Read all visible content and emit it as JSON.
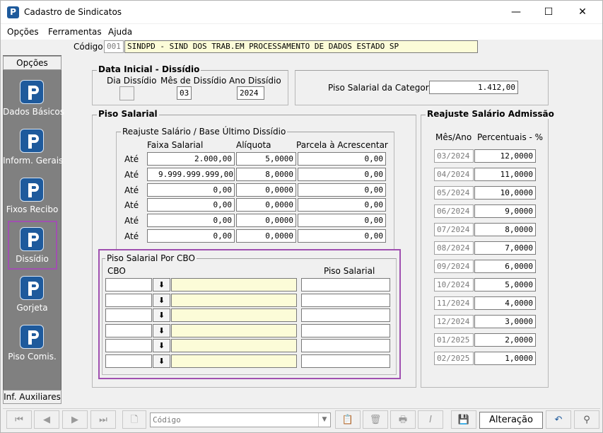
{
  "window": {
    "title": "Cadastro de Sindicatos",
    "minimize": "—",
    "maximize": "☐",
    "close": "✕"
  },
  "menu": [
    "Opções",
    "Ferramentas",
    "Ajuda"
  ],
  "codigo": {
    "label": "Código:",
    "code": "001",
    "name": "SINDPD - SIND DOS TRAB.EM PROCESSAMENTO DE DADOS ESTADO SP"
  },
  "sidebar": {
    "header": "Opções",
    "footer": "Inf. Auxiliares",
    "items": [
      {
        "label": "Dados Básicos",
        "selected": false
      },
      {
        "label": "Inform. Gerais",
        "selected": false
      },
      {
        "label": "Fixos Recibo",
        "selected": false
      },
      {
        "label": "Dissídio",
        "selected": true
      },
      {
        "label": "Gorjeta",
        "selected": false
      },
      {
        "label": "Piso Comis.",
        "selected": false
      }
    ]
  },
  "data_inicial": {
    "title": "Data Inicial - Dissídio",
    "dia_label": "Dia Dissídio",
    "dia_value": "",
    "mes_label": "Mês de Dissídio",
    "mes_value": "03",
    "ano_label": "Ano Dissídio",
    "ano_value": "2024"
  },
  "piso_categoria": {
    "label": "Piso Salarial da Categoria:",
    "value": "1.412,00"
  },
  "piso_salarial": {
    "title": "Piso Salarial",
    "reajuste_title": "Reajuste Salário / Base Último Dissídio",
    "headers": [
      "Faixa Salarial",
      "Alíquota",
      "Parcela à Acrescentar"
    ],
    "rows": [
      {
        "prefix": "Até",
        "faixa": "2.000,00",
        "aliquota": "5,0000",
        "parcela": "0,00"
      },
      {
        "prefix": "Até",
        "faixa": "9.999.999.999,00",
        "aliquota": "8,0000",
        "parcela": "0,00"
      },
      {
        "prefix": "Até",
        "faixa": "0,00",
        "aliquota": "0,0000",
        "parcela": "0,00"
      },
      {
        "prefix": "Até",
        "faixa": "0,00",
        "aliquota": "0,0000",
        "parcela": "0,00"
      },
      {
        "prefix": "Até",
        "faixa": "0,00",
        "aliquota": "0,0000",
        "parcela": "0,00"
      },
      {
        "prefix": "Até",
        "faixa": "0,00",
        "aliquota": "0,0000",
        "parcela": "0,00"
      }
    ]
  },
  "piso_cbo": {
    "title": "Piso Salarial Por CBO",
    "cbo_label": "CBO",
    "piso_label": "Piso Salarial",
    "rows": [
      {
        "cbo": "",
        "desc": "",
        "piso": ""
      },
      {
        "cbo": "",
        "desc": "",
        "piso": ""
      },
      {
        "cbo": "",
        "desc": "",
        "piso": ""
      },
      {
        "cbo": "",
        "desc": "",
        "piso": ""
      },
      {
        "cbo": "",
        "desc": "",
        "piso": ""
      },
      {
        "cbo": "",
        "desc": "",
        "piso": ""
      }
    ]
  },
  "reajuste_admissao": {
    "title": "Reajuste Salário Admissão",
    "col_mes": "Mês/Ano",
    "col_pct": "Percentuais - %",
    "rows": [
      {
        "mes": "03/2024",
        "pct": "12,0000"
      },
      {
        "mes": "04/2024",
        "pct": "11,0000"
      },
      {
        "mes": "05/2024",
        "pct": "10,0000"
      },
      {
        "mes": "06/2024",
        "pct": "9,0000"
      },
      {
        "mes": "07/2024",
        "pct": "8,0000"
      },
      {
        "mes": "08/2024",
        "pct": "7,0000"
      },
      {
        "mes": "09/2024",
        "pct": "6,0000"
      },
      {
        "mes": "10/2024",
        "pct": "5,0000"
      },
      {
        "mes": "11/2024",
        "pct": "4,0000"
      },
      {
        "mes": "12/2024",
        "pct": "3,0000"
      },
      {
        "mes": "01/2025",
        "pct": "2,0000"
      },
      {
        "mes": "02/2025",
        "pct": "1,0000"
      }
    ]
  },
  "toolbar": {
    "search_placeholder": "Código",
    "status": "Alteração",
    "buttons": [
      "first-icon",
      "prev-icon",
      "next-icon",
      "last-icon",
      "new-doc-icon",
      "copy-icon",
      "delete-icon",
      "print-icon",
      "italic-icon",
      "save-icon",
      "undo-icon",
      "binoculars-icon"
    ]
  },
  "colors": {
    "accent_icon": "#1e5a9c",
    "highlight_border": "#a050b0",
    "yellow_field": "#fcfcd8",
    "sidebar_bg": "#808080"
  }
}
